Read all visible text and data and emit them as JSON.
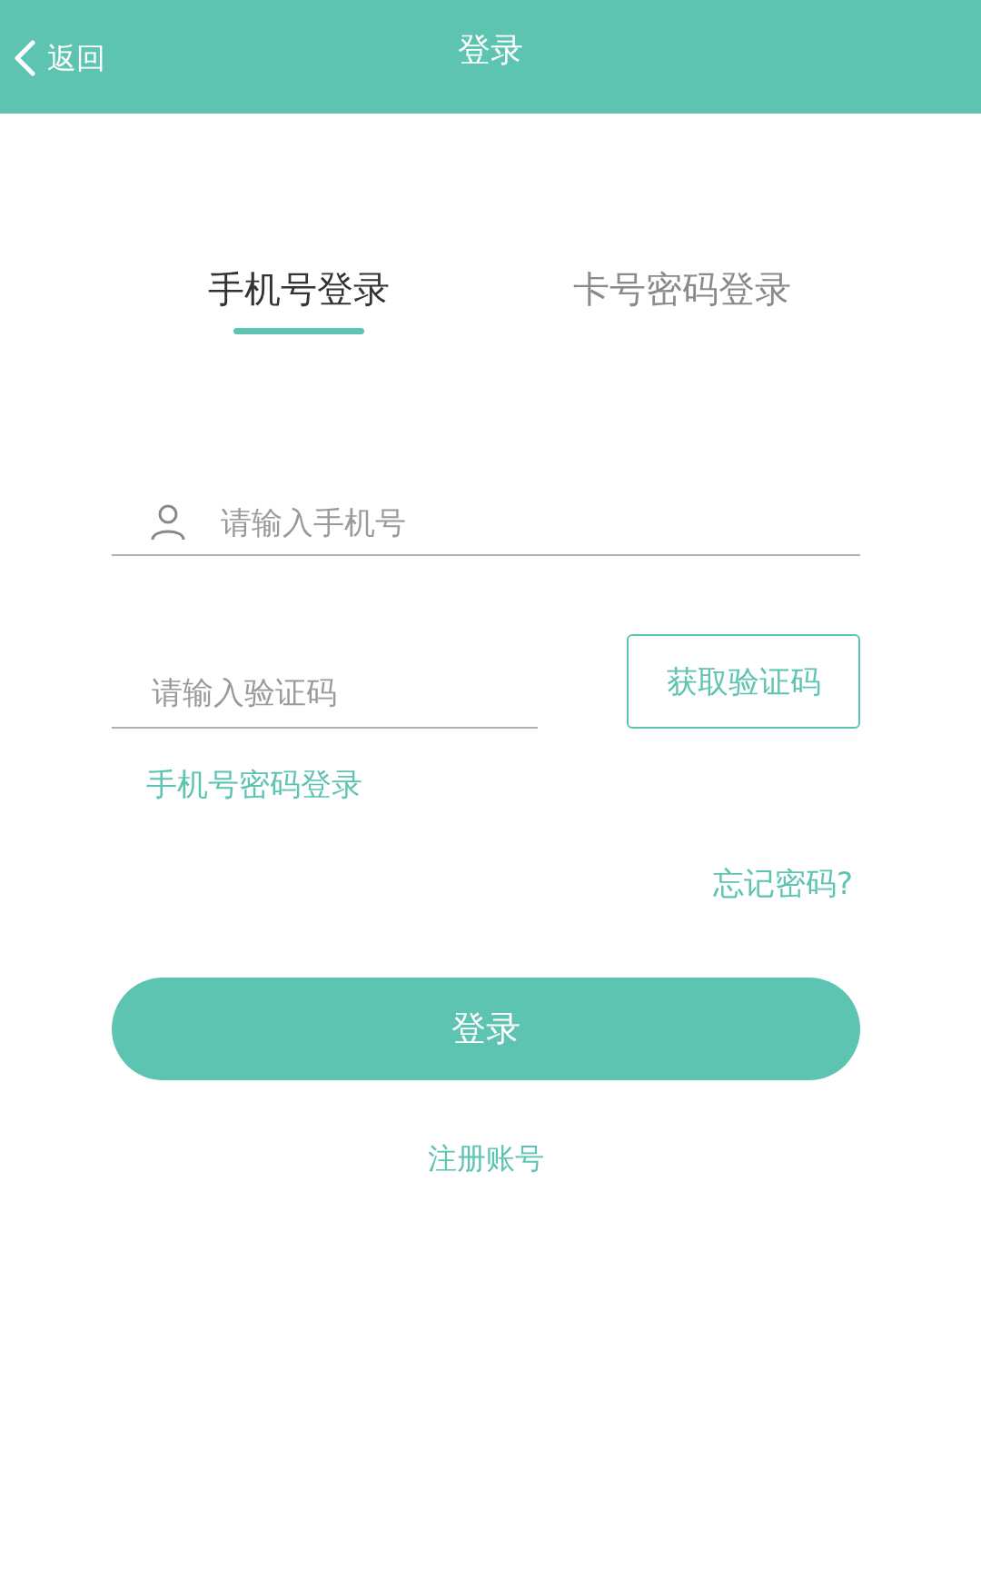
{
  "header": {
    "back": "返回",
    "title": "登录"
  },
  "tabs": [
    {
      "label": "手机号登录",
      "selected": true
    },
    {
      "label": "卡号密码登录",
      "selected": false
    }
  ],
  "phone_field": {
    "placeholder": "请输入手机号"
  },
  "code_field": {
    "placeholder": "请输入验证码"
  },
  "get_code_button": "获取验证码",
  "alt_login_link": "手机号密码登录",
  "forgot_link": "忘记密码?",
  "login_button": "登录",
  "register_link": "注册账号"
}
